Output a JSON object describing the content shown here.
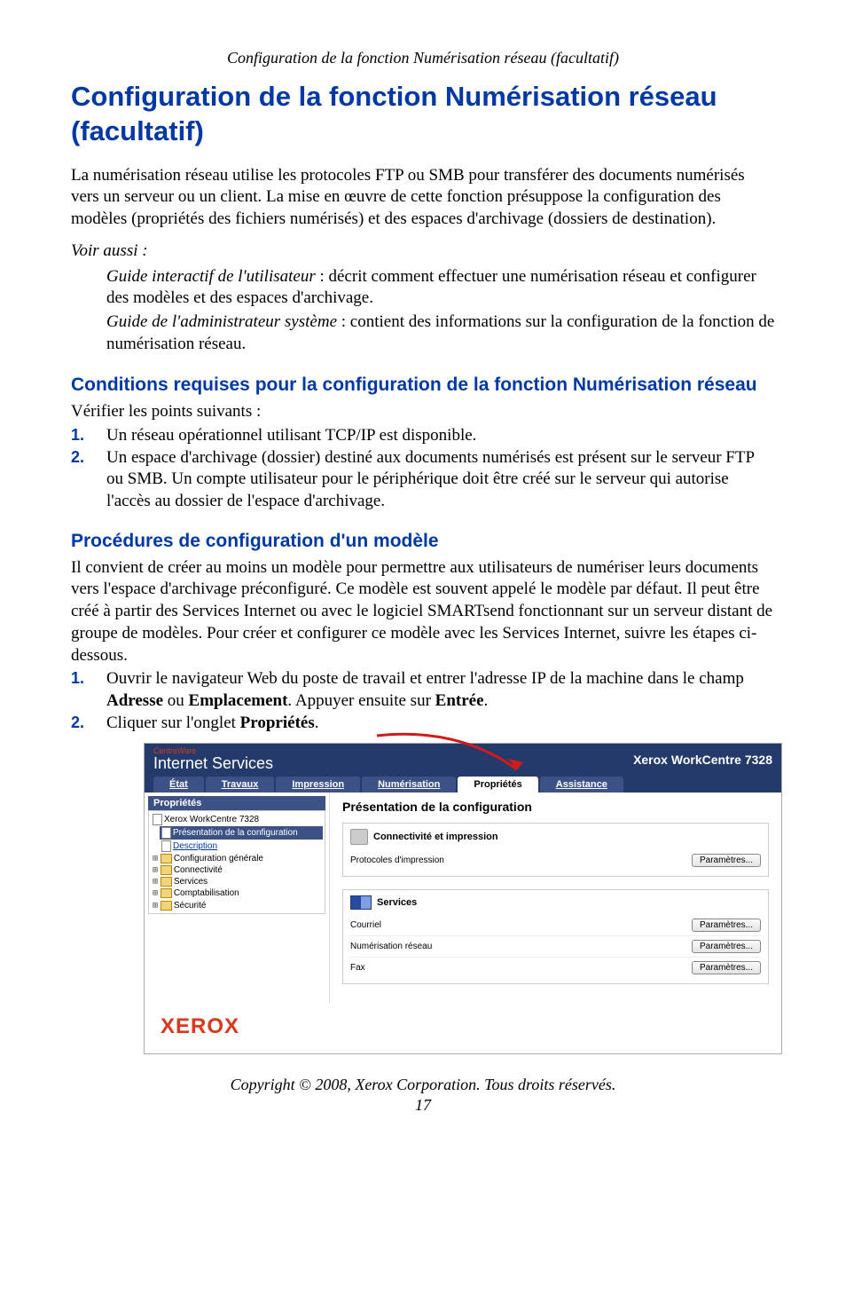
{
  "running_header": "Configuration de la fonction Numérisation réseau (facultatif)",
  "title": "Configuration de la fonction Numérisation réseau (facultatif)",
  "intro": "La numérisation réseau utilise les protocoles FTP ou SMB pour transférer des documents numérisés vers un serveur ou un client. La mise en œuvre de cette fonction présuppose la configuration des modèles (propriétés des fichiers numérisés) et des espaces d'archivage (dossiers de destination).",
  "see_also_label": "Voir aussi :",
  "see_also": [
    {
      "title": "Guide interactif de l'utilisateur",
      "desc": " : décrit comment effectuer une numérisation réseau et configurer des modèles et des espaces d'archivage."
    },
    {
      "title": "Guide de l'administrateur système",
      "desc": " : contient des informations sur la configuration de la fonction de numérisation réseau."
    }
  ],
  "section1_title": "Conditions requises pour la configuration de la fonction Numérisation réseau",
  "section1_lead": "Vérifier les points suivants :",
  "section1_items": [
    "Un réseau opérationnel utilisant TCP/IP est disponible.",
    "Un espace d'archivage (dossier) destiné aux documents numérisés est présent sur le serveur FTP ou SMB. Un compte utilisateur pour le périphérique doit être créé sur le serveur qui autorise l'accès au dossier de l'espace d'archivage."
  ],
  "section2_title": "Procédures de configuration d'un modèle",
  "section2_body": "Il convient de créer au moins un modèle pour permettre aux utilisateurs de numériser leurs documents vers l'espace d'archivage préconfiguré. Ce modèle est souvent appelé le modèle par défaut. Il peut être créé à partir des Services Internet ou avec le logiciel SMARTsend fonctionnant sur un serveur distant de groupe de modèles. Pour créer et configurer ce modèle avec les Services Internet, suivre les étapes ci-dessous.",
  "section2_step1_pre": "Ouvrir le navigateur Web du poste de travail et entrer l'adresse IP de la machine dans le champ ",
  "section2_step1_b1": "Adresse",
  "section2_step1_mid": " ou ",
  "section2_step1_b2": "Emplacement",
  "section2_step1_mid2": ". Appuyer ensuite sur ",
  "section2_step1_b3": "Entrée",
  "section2_step1_post": ".",
  "section2_step2_pre": "Cliquer sur l'onglet ",
  "section2_step2_b1": "Propriétés",
  "section2_step2_post": ".",
  "screenshot": {
    "brand_small": "CentreWare",
    "brand_big": "Internet Services",
    "model": "Xerox WorkCentre 7328",
    "tabs": [
      "État",
      "Travaux",
      "Impression",
      "Numérisation",
      "Propriétés",
      "Assistance"
    ],
    "sidebar_title": "Propriétés",
    "tree": {
      "root": "Xerox WorkCentre 7328",
      "items": [
        {
          "label": "Présentation de la configuration",
          "selected": true,
          "icon": "page"
        },
        {
          "label": "Description",
          "link": true,
          "icon": "page"
        },
        {
          "label": "Configuration générale",
          "expandable": true,
          "icon": "folder"
        },
        {
          "label": "Connectivité",
          "expandable": true,
          "icon": "folder"
        },
        {
          "label": "Services",
          "expandable": true,
          "icon": "folder"
        },
        {
          "label": "Comptabilisation",
          "expandable": true,
          "icon": "folder"
        },
        {
          "label": "Sécurité",
          "expandable": true,
          "icon": "folder"
        }
      ]
    },
    "content_title": "Présentation de la configuration",
    "box1_title": "Connectivité et impression",
    "box1_rows": [
      {
        "label": "Protocoles d'impression",
        "btn": "Paramètres..."
      }
    ],
    "box2_title": "Services",
    "box2_rows": [
      {
        "label": "Courriel",
        "btn": "Paramètres..."
      },
      {
        "label": "Numérisation réseau",
        "btn": "Paramètres..."
      },
      {
        "label": "Fax",
        "btn": "Paramètres..."
      }
    ],
    "footer_logo": "XEROX"
  },
  "copyright": "Copyright © 2008, Xerox Corporation. Tous droits réservés.",
  "page_number": "17"
}
